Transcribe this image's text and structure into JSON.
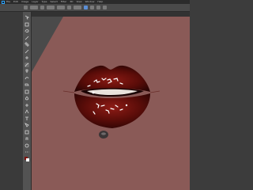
{
  "app": {
    "menus": [
      "File",
      "Edit",
      "Image",
      "Layer",
      "Type",
      "Select",
      "Filter",
      "3D",
      "View",
      "Window",
      "Help"
    ]
  },
  "colors": {
    "canvas_background": "#8a5a57",
    "lip_dark": "#3a0806",
    "lip_mid": "#7a1410",
    "lip_highlight": "#b0302a",
    "teeth": "#e8e2dc",
    "interface": "#535353"
  },
  "tools": [
    "move-tool-icon",
    "marquee-tool-icon",
    "lasso-tool-icon",
    "quick-select-tool-icon",
    "crop-tool-icon",
    "eyedropper-tool-icon",
    "healing-brush-tool-icon",
    "brush-tool-icon",
    "clone-stamp-tool-icon",
    "history-brush-tool-icon",
    "eraser-tool-icon",
    "gradient-tool-icon",
    "blur-tool-icon",
    "dodge-tool-icon",
    "pen-tool-icon",
    "type-tool-icon",
    "path-selection-tool-icon",
    "shape-tool-icon",
    "hand-tool-icon",
    "zoom-tool-icon",
    "edit-toolbar-icon",
    "color-swatches-icon"
  ],
  "active_tool": "brush-tool-icon"
}
